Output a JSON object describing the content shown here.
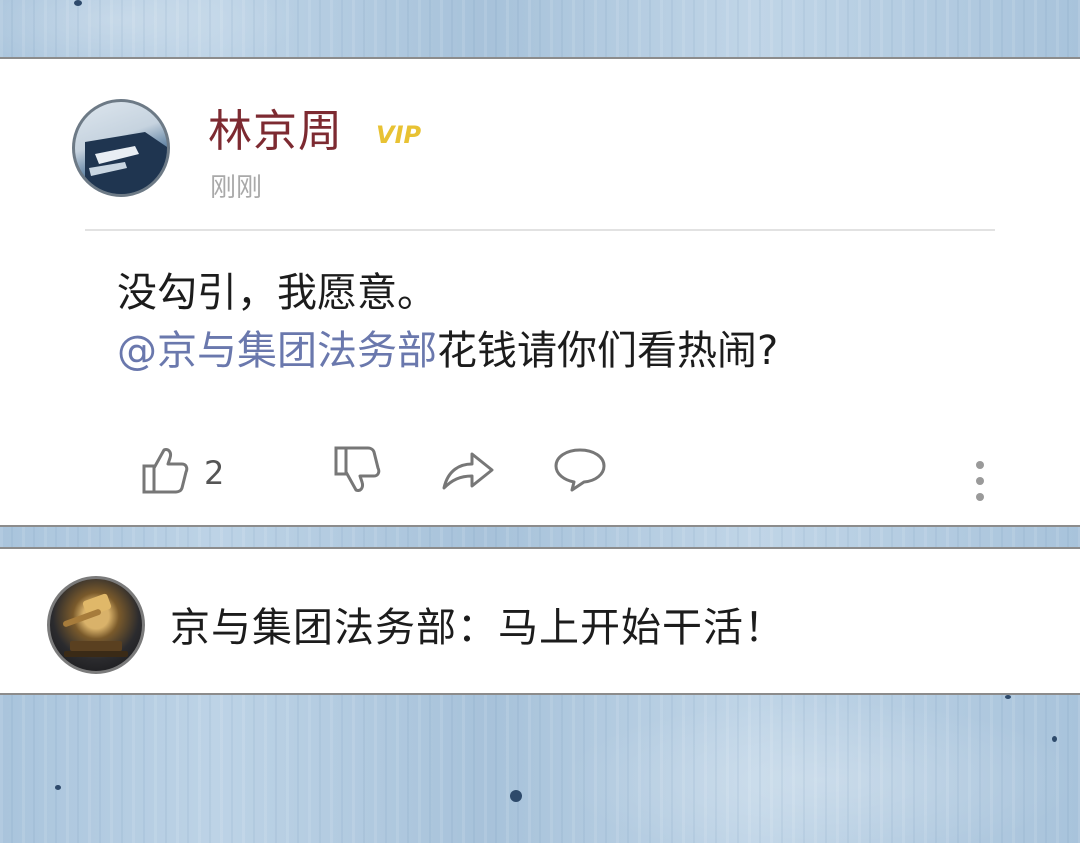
{
  "post": {
    "username": "林京周",
    "badge": "VIP",
    "timestamp": "刚刚",
    "line1": "没勾引，我愿意。",
    "mention": "@京与集团法务部",
    "line2_rest": "花钱请你们看热闹?",
    "actions": {
      "like_count": "2",
      "like_icon": "thumbs-up-icon",
      "dislike_icon": "thumbs-down-icon",
      "share_icon": "share-arrow-icon",
      "comment_icon": "comment-bubble-icon",
      "more_icon": "more-vertical-icon"
    }
  },
  "reply": {
    "text": "京与集团法务部：马上开始干活！"
  },
  "colors": {
    "username": "#7d2a31",
    "vip_badge": "#e8c233",
    "mention": "#6a78ad",
    "timestamp": "#a9a9a9",
    "background": "#b4cde2"
  }
}
